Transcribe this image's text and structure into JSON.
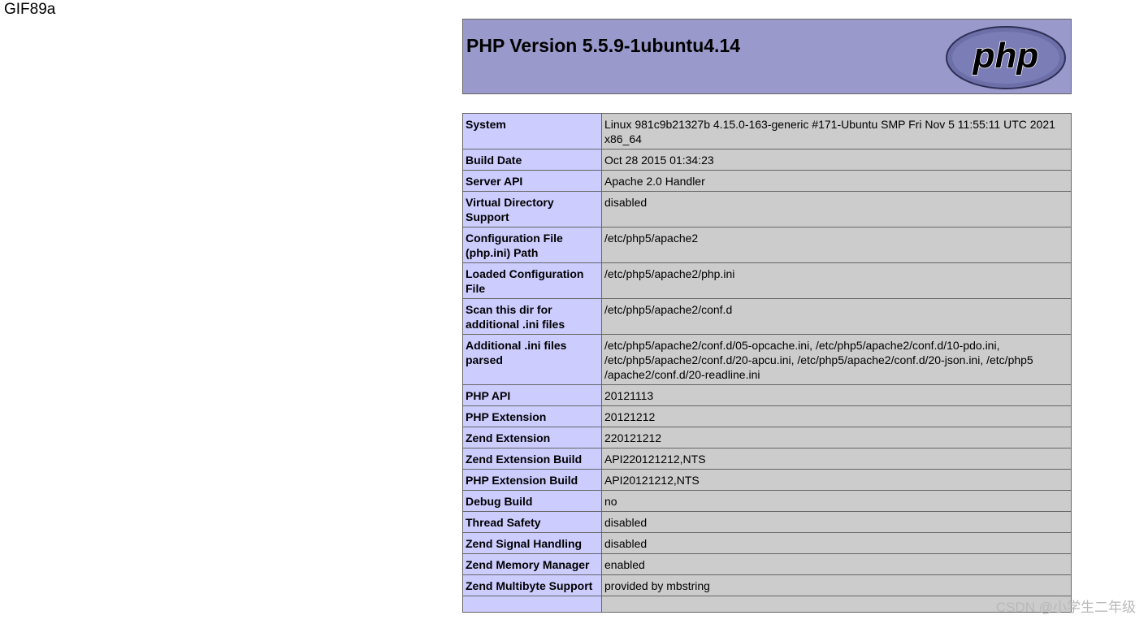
{
  "gif_header": "GIF89a",
  "header": {
    "title": "PHP Version 5.5.9-1ubuntu4.14",
    "logo_text": "php",
    "colors": {
      "header_bg": "#9999cc",
      "label_bg": "#ccccff",
      "value_bg": "#cccccc",
      "border": "#666666"
    }
  },
  "rows": [
    {
      "label": "System",
      "value": "Linux 981c9b21327b 4.15.0-163-generic #171-Ubuntu SMP Fri Nov 5 11:55:11 UTC 2021 x86_64"
    },
    {
      "label": "Build Date",
      "value": "Oct 28 2015 01:34:23"
    },
    {
      "label": "Server API",
      "value": "Apache 2.0 Handler"
    },
    {
      "label": "Virtual Directory Support",
      "value": "disabled"
    },
    {
      "label": "Configuration File (php.ini) Path",
      "value": "/etc/php5/apache2"
    },
    {
      "label": "Loaded Configuration File",
      "value": "/etc/php5/apache2/php.ini"
    },
    {
      "label": "Scan this dir for additional .ini files",
      "value": "/etc/php5/apache2/conf.d"
    },
    {
      "label": "Additional .ini files parsed",
      "value": "/etc/php5/apache2/conf.d/05-opcache.ini, /etc/php5/apache2/conf.d/10-pdo.ini, /etc/php5/apache2/conf.d/20-apcu.ini, /etc/php5/apache2/conf.d/20-json.ini, /etc/php5 /apache2/conf.d/20-readline.ini"
    },
    {
      "label": "PHP API",
      "value": "20121113"
    },
    {
      "label": "PHP Extension",
      "value": "20121212"
    },
    {
      "label": "Zend Extension",
      "value": "220121212"
    },
    {
      "label": "Zend Extension Build",
      "value": "API220121212,NTS"
    },
    {
      "label": "PHP Extension Build",
      "value": "API20121212,NTS"
    },
    {
      "label": "Debug Build",
      "value": "no"
    },
    {
      "label": "Thread Safety",
      "value": "disabled"
    },
    {
      "label": "Zend Signal Handling",
      "value": "disabled"
    },
    {
      "label": "Zend Memory Manager",
      "value": "enabled"
    },
    {
      "label": "Zend Multibyte Support",
      "value": "provided by mbstring"
    },
    {
      "label": "",
      "value": ""
    }
  ],
  "watermark": "CSDN @小学生二年级"
}
